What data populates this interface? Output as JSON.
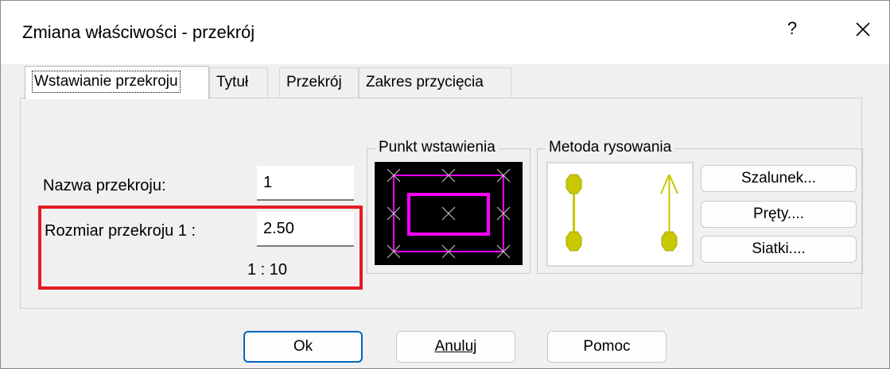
{
  "window": {
    "title": "Zmiana właściwości - przekrój",
    "help_label": "?",
    "close_icon": "close-icon"
  },
  "tabs": [
    {
      "label": "Wstawianie przekroju",
      "active": true
    },
    {
      "label": "Tytuł",
      "active": false
    },
    {
      "label": "Przekrój",
      "active": false
    },
    {
      "label": "Zakres przycięcia",
      "active": false
    }
  ],
  "form": {
    "name_label": "Nazwa przekroju:",
    "name_value": "1",
    "size_label": "Rozmiar przekroju  1 :",
    "size_value": "2.50",
    "scale_text": "1 : 10"
  },
  "insertion_point": {
    "title": "Punkt wstawienia",
    "marker_color": "#cfcfcf",
    "frame_color": "#ff00ff"
  },
  "drawing_method": {
    "title": "Metoda rysowania",
    "icon_color": "#c8c800",
    "buttons": [
      {
        "label": "Szalunek..."
      },
      {
        "label": "Pręty...."
      },
      {
        "label": "Siatki...."
      }
    ]
  },
  "footer": {
    "ok_label": "Ok",
    "cancel_label": "Anuluj",
    "help_label": "Pomoc"
  },
  "colors": {
    "highlight": "#e31b23",
    "default_button_border": "#0067c0"
  }
}
